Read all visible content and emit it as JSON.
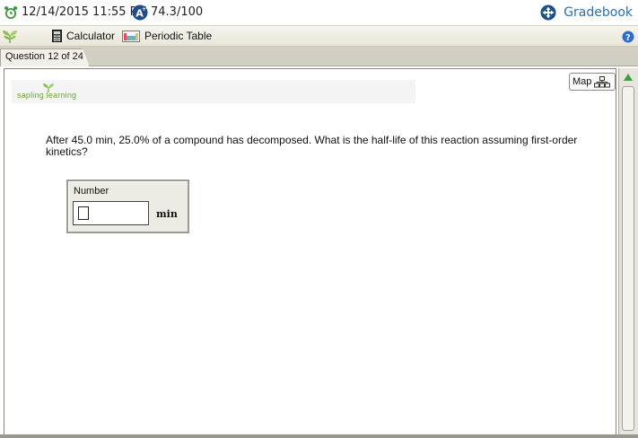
{
  "status": {
    "datetime": "12/14/2015 11:55 PM",
    "score": "74.3/100",
    "gradebook_label": "Gradebook"
  },
  "toolbar": {
    "calculator_label": "Calculator",
    "periodic_table_label": "Periodic Table"
  },
  "tabs": [
    {
      "label": "Question 12 of 24"
    }
  ],
  "content": {
    "logo_text": "sapling learning",
    "map_label": "Map",
    "question_text": "After 45.0 min, 25.0% of a compound has decomposed. What is the half-life of this reaction assuming first-order kinetics?",
    "answer": {
      "label": "Number",
      "value": "",
      "unit": "min"
    }
  },
  "colors": {
    "accent": "#2a6fb2",
    "brand_green": "#6aa83b",
    "clock_green": "#3a9a3a",
    "score_blue": "#1d4f8c"
  }
}
